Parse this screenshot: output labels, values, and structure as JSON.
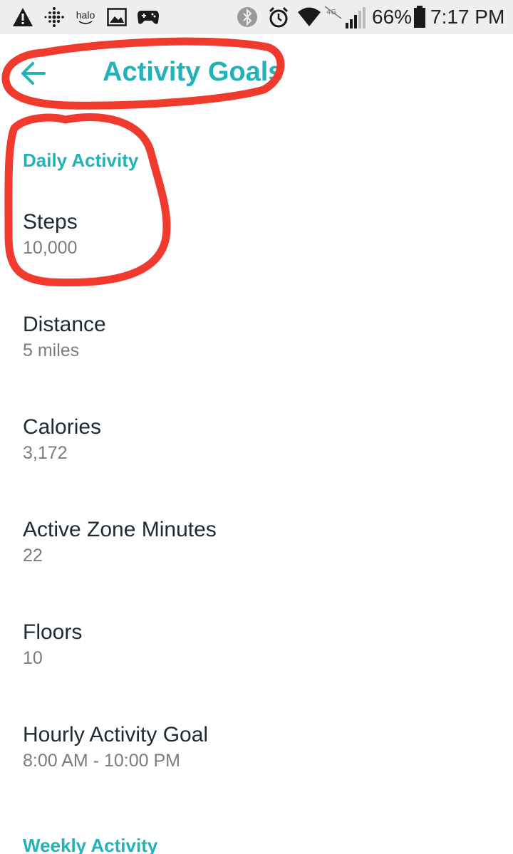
{
  "status_bar": {
    "halo_label": "halo",
    "battery": "66%",
    "time": "7:17 PM",
    "network_label": "4G",
    "icons": [
      "warning-icon",
      "fitbit-icon",
      "halo-app-icon",
      "image-icon",
      "gamepad-icon",
      "bluetooth-icon",
      "alarm-icon",
      "wifi-icon",
      "mobile-data-icon",
      "signal-icon",
      "battery-icon"
    ]
  },
  "header": {
    "title": "Activity Goals",
    "back_icon": "arrow-left-icon"
  },
  "sections": [
    {
      "title": "Daily Activity",
      "items": [
        {
          "name": "Steps",
          "value": "10,000"
        },
        {
          "name": "Distance",
          "value": "5 miles"
        },
        {
          "name": "Calories",
          "value": "3,172"
        },
        {
          "name": "Active Zone Minutes",
          "value": "22"
        },
        {
          "name": "Floors",
          "value": "10"
        },
        {
          "name": "Hourly Activity Goal",
          "value": "8:00 AM - 10:00 PM"
        }
      ]
    },
    {
      "title": "Weekly Activity",
      "items": []
    }
  ],
  "colors": {
    "accent": "#23b2b8",
    "primary_text": "#1d2a33",
    "secondary_text": "#7a7d80",
    "status_bar_bg": "#eeeeee",
    "annotation": "#f03a2e"
  }
}
